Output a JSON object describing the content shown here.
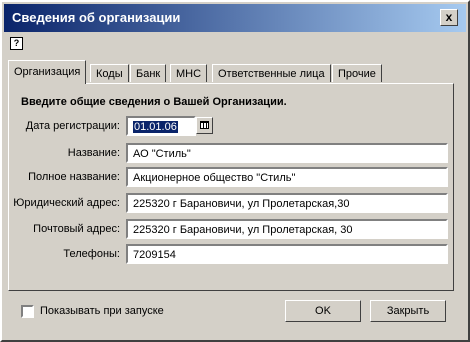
{
  "window": {
    "title": "Сведения об организации",
    "close_label": "x"
  },
  "help_label": "?",
  "tabs": [
    "Организация",
    "Коды",
    "Банк",
    "МНС",
    "Ответственные лица",
    "Прочие"
  ],
  "heading": "Введите общие сведения о Вашей Организации.",
  "fields": [
    {
      "label": "Дата регистрации:",
      "value": "01.01.06"
    },
    {
      "label": "Название:",
      "value": "АО \"Стиль\""
    },
    {
      "label": "Полное название:",
      "value": "Акционерное общество \"Стиль\""
    },
    {
      "label": "Юридический адрес:",
      "value": "225320 г Барановичи, ул Пролетарская,30"
    },
    {
      "label": "Почтовый адрес:",
      "value": "225320 г Барановичи, ул Пролетарская, 30"
    },
    {
      "label": "Телефоны:",
      "value": "7209154"
    }
  ],
  "show_on_start_label": "Показывать при запуске",
  "buttons": {
    "ok": "OK",
    "close": "Закрыть"
  }
}
